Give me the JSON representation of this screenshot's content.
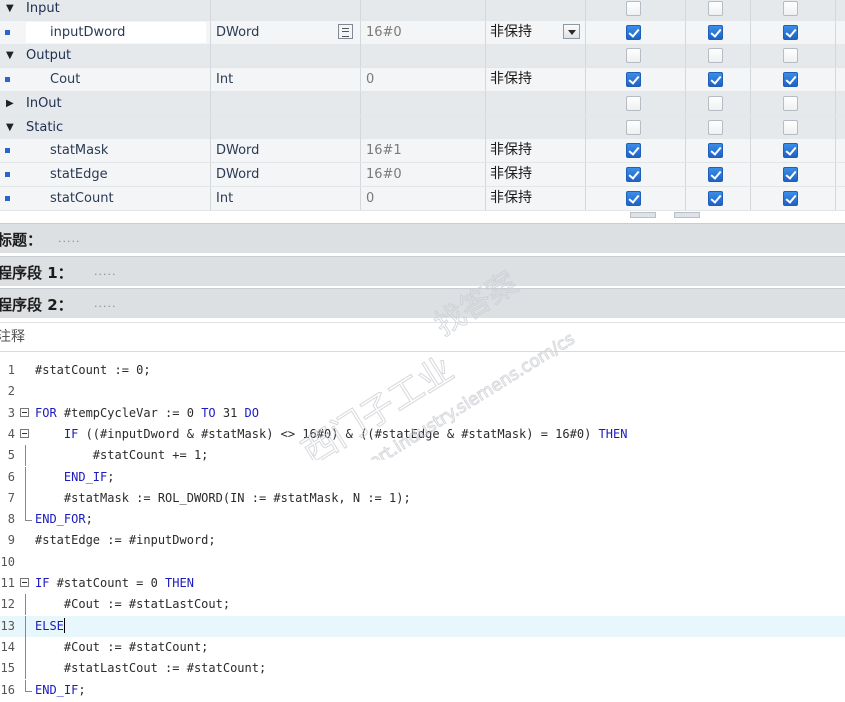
{
  "interface": {
    "rows": [
      {
        "kind": "section",
        "expanded": true,
        "name": "Input",
        "checks": [
          false,
          false,
          false
        ]
      },
      {
        "kind": "var",
        "name": "inputDword",
        "type": "DWord",
        "default": "16#0",
        "retain": "非保持",
        "checks": [
          true,
          true,
          true
        ]
      },
      {
        "kind": "section",
        "expanded": true,
        "name": "Output",
        "checks": [
          false,
          false,
          false
        ]
      },
      {
        "kind": "var",
        "name": "Cout",
        "type": "Int",
        "default": "0",
        "retain": "非保持",
        "checks": [
          true,
          true,
          true
        ]
      },
      {
        "kind": "section",
        "expanded": false,
        "name": "InOut",
        "checks": [
          false,
          false,
          false
        ]
      },
      {
        "kind": "section",
        "expanded": true,
        "name": "Static",
        "checks": [
          false,
          false,
          false
        ]
      },
      {
        "kind": "var",
        "name": "statMask",
        "type": "DWord",
        "default": "16#1",
        "retain": "非保持",
        "checks": [
          true,
          true,
          true
        ]
      },
      {
        "kind": "var",
        "name": "statEdge",
        "type": "DWord",
        "default": "16#0",
        "retain": "非保持",
        "checks": [
          true,
          true,
          true
        ]
      },
      {
        "kind": "var",
        "name": "statCount",
        "type": "Int",
        "default": "0",
        "retain": "非保持",
        "checks": [
          true,
          true,
          true
        ]
      }
    ]
  },
  "block_title": {
    "label": "标题：",
    "placeholder": "....."
  },
  "networks": [
    {
      "label": "程序段 1：",
      "placeholder": "....."
    },
    {
      "label": "程序段 2：",
      "placeholder": "....."
    }
  ],
  "comment_label": "注释",
  "code_lines": [
    {
      "n": "1",
      "text": "#statCount := 0;"
    },
    {
      "n": "2",
      "text": ""
    },
    {
      "n": "3",
      "text": "FOR #tempCycleVar := 0 TO 31 DO"
    },
    {
      "n": "4",
      "text": "    IF ((#inputDword & #statMask) <> 16#0) & ((#statEdge & #statMask) = 16#0) THEN"
    },
    {
      "n": "5",
      "text": "        #statCount += 1;"
    },
    {
      "n": "6",
      "text": "    END_IF;"
    },
    {
      "n": "7",
      "text": "    #statMask := ROL_DWORD(IN := #statMask, N := 1);"
    },
    {
      "n": "8",
      "text": "END_FOR;"
    },
    {
      "n": "9",
      "text": "#statEdge := #inputDword;"
    },
    {
      "n": "10",
      "text": ""
    },
    {
      "n": "11",
      "text": "IF #statCount = 0 THEN"
    },
    {
      "n": "12",
      "text": "    #Cout := #statLastCout;"
    },
    {
      "n": "13",
      "text": "ELSE"
    },
    {
      "n": "14",
      "text": "    #Cout := #statCount;"
    },
    {
      "n": "15",
      "text": "    #statLastCout := #statCount;"
    },
    {
      "n": "16",
      "text": "END_IF;"
    }
  ],
  "keywords": [
    "FOR",
    "TO",
    "DO",
    "IF",
    "THEN",
    "END_IF",
    "END_FOR",
    "ELSE"
  ],
  "watermark": {
    "line1": "西门子工业",
    "line2": "找答案",
    "line3": "support.industry.siemens.com/cs"
  },
  "colors": {
    "keyword": "#1b1bbf",
    "checked": "#1e62c4",
    "current_line": "#e8f7fb"
  }
}
